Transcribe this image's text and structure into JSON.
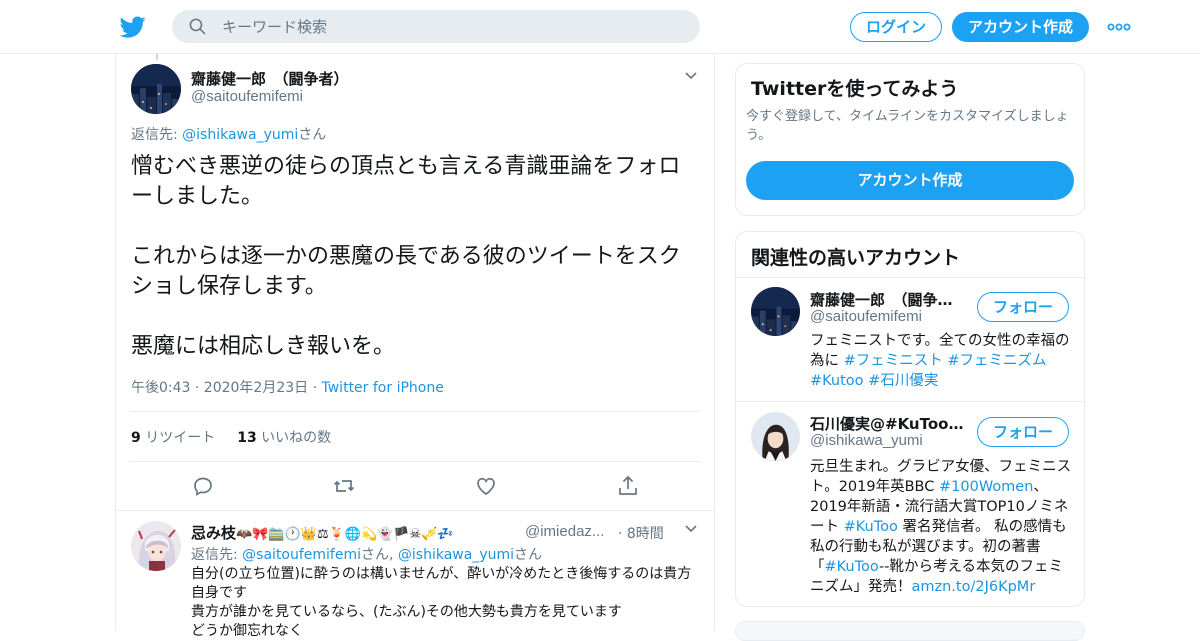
{
  "header": {
    "search_placeholder": "キーワード検索",
    "login_label": "ログイン",
    "signup_label": "アカウント作成"
  },
  "tweet": {
    "author_name": "齋藤健一郎　（闘争者）",
    "author_handle": "@saitoufemifemi",
    "replying_label": "返信先: ",
    "replying_to": "@ishikawa_yumi",
    "replying_suffix": "さん",
    "text": "憎むべき悪逆の徒らの頂点とも言える青識亜論をフォローしました。\n\nこれからは逐一かの悪魔の長である彼のツイートをスクショし保存します。\n\n悪魔には相応しき報いを。",
    "timestamp": "午後0:43 · 2020年2月23日 · ",
    "source": "Twitter for iPhone",
    "retweet_count": "9",
    "retweet_label": "リツイート",
    "like_count": "13",
    "like_label": "いいねの数"
  },
  "reply": {
    "author_name": "忌み枝🦇🎀�when🕐👑⚖🍹🌐💫👻🏴☠🎺💤",
    "author_name_clean": "忌み枝",
    "author_emoji": "🦇🎀🚞🕐👑⚖🍹🌐💫👻🏴☠🎺💤",
    "author_handle": "@imiedaz...",
    "time": "· 8時間",
    "replying_label": "返信先: ",
    "replying_to_1": "@saitoufemifemi",
    "replying_mid": "さん, ",
    "replying_to_2": "@ishikawa_yumi",
    "replying_suffix": "さん",
    "text": "自分(の立ち位置)に酔うのは構いませんが、酔いが冷めたとき後悔するのは貴方自身です\n貴方が誰かを見ているなら、(たぶん)その他大勢も貴方を見ています\nどうか御忘れなく"
  },
  "sidebar": {
    "try_card": {
      "title": "Twitterを使ってみよう",
      "desc": "今すぐ登録して、タイムラインをカスタマイズしましょう。",
      "cta": "アカウント作成"
    },
    "related": {
      "title": "関連性の高いアカウント",
      "accounts": [
        {
          "name": "齋藤健一郎　（闘争者）",
          "handle": "@saitoufemifemi",
          "follow": "フォロー",
          "bio_text": "フェミニストです。全ての女性の幸福の為に ",
          "bio_tag1": "#フェミニスト",
          "bio_tag2": "#フェミニズム",
          "bio_tag3": "#Kutoo",
          "bio_tag4": "#石川優実"
        },
        {
          "name": "石川優実@#KuToo署名",
          "handle": "@ishikawa_yumi",
          "follow": "フォロー",
          "bio_1": "元旦生まれ。グラビア女優、フェミニスト。2019年英BBC ",
          "bio_tag1": "#100Women",
          "bio_2": "、2019年新語・流行語大賞TOP10ノミネート ",
          "bio_tag2": "#KuToo",
          "bio_3": " 署名発信者。 私の感情も私の行動も私が選びます。初の著書「",
          "bio_tag3": "#KuToo",
          "bio_4": "--靴から考える本気のフェミニズム」発売！",
          "bio_link": "amzn.to/2J6KpMr"
        }
      ]
    }
  },
  "colors": {
    "accent": "#1da1f2",
    "link": "#1b95e0",
    "muted": "#657786",
    "border": "#e6ecf0"
  },
  "icons": [
    "twitter-bird-icon",
    "search-icon",
    "more-icon",
    "chevron-down-icon",
    "reply-icon",
    "retweet-icon",
    "like-icon",
    "share-icon"
  ]
}
